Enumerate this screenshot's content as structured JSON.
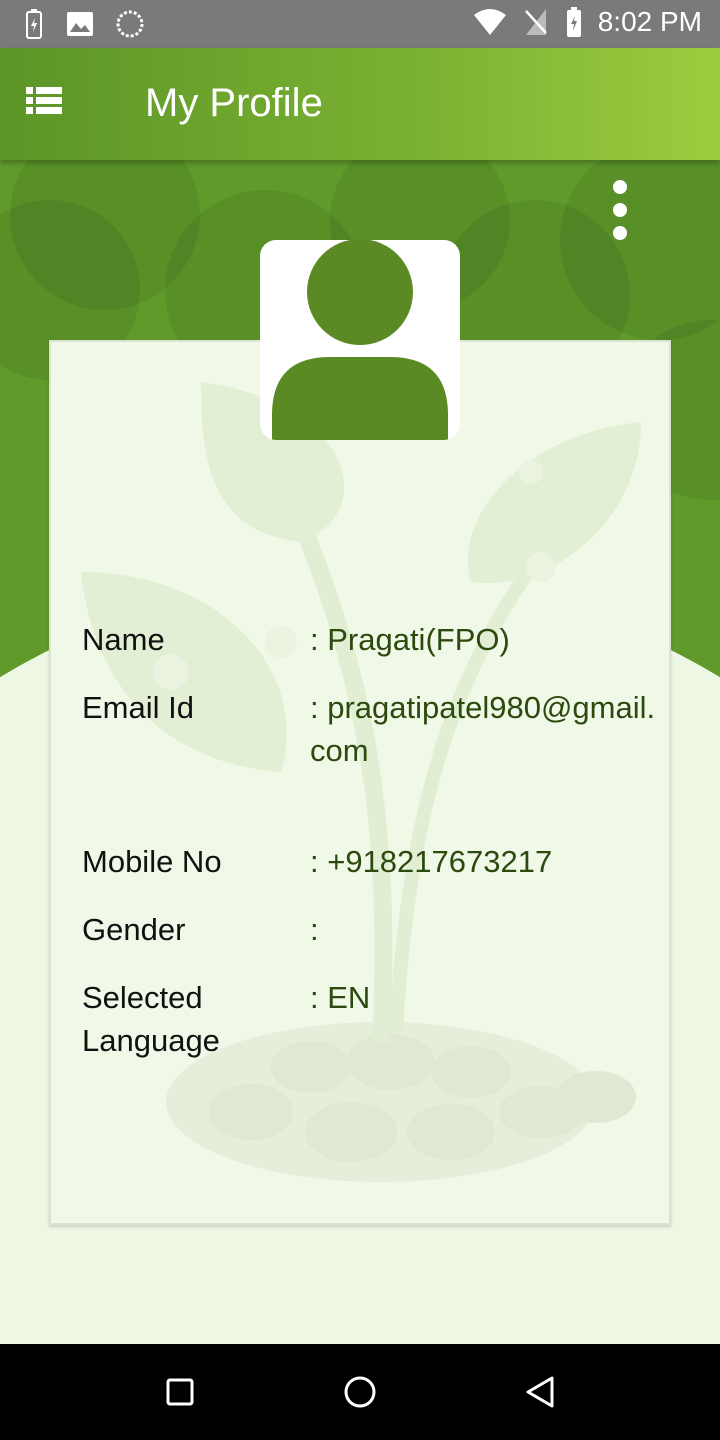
{
  "status_bar": {
    "time": "8:02 PM",
    "left_icons": [
      "battery-charging-icon",
      "image-icon",
      "loading-icon"
    ],
    "right_icons": [
      "wifi-icon",
      "no-sim-icon",
      "battery-icon"
    ]
  },
  "app_bar": {
    "title": "My Profile",
    "menu_icon": "list-menu-icon"
  },
  "overflow_icon": "more-vert-icon",
  "profile": {
    "avatar_icon": "person-avatar-icon",
    "fields": [
      {
        "label": "Name",
        "value": ": Pragati(FPO)"
      },
      {
        "label": "Email Id",
        "value": ": pragatipatel980@gmail.com"
      },
      {
        "label": "Mobile No",
        "value": ": +918217673217"
      },
      {
        "label": "Gender",
        "value": ":"
      },
      {
        "label": "Selected Language",
        "value": ": EN"
      }
    ]
  },
  "nav_bar": {
    "icons": [
      "recents-square-icon",
      "home-circle-icon",
      "back-triangle-icon"
    ]
  },
  "colors": {
    "primary_green": "#5f9a2b",
    "light_green": "#9ccc3f",
    "card_bg": "#f0f8e7",
    "value_text": "#2c4a0e"
  }
}
